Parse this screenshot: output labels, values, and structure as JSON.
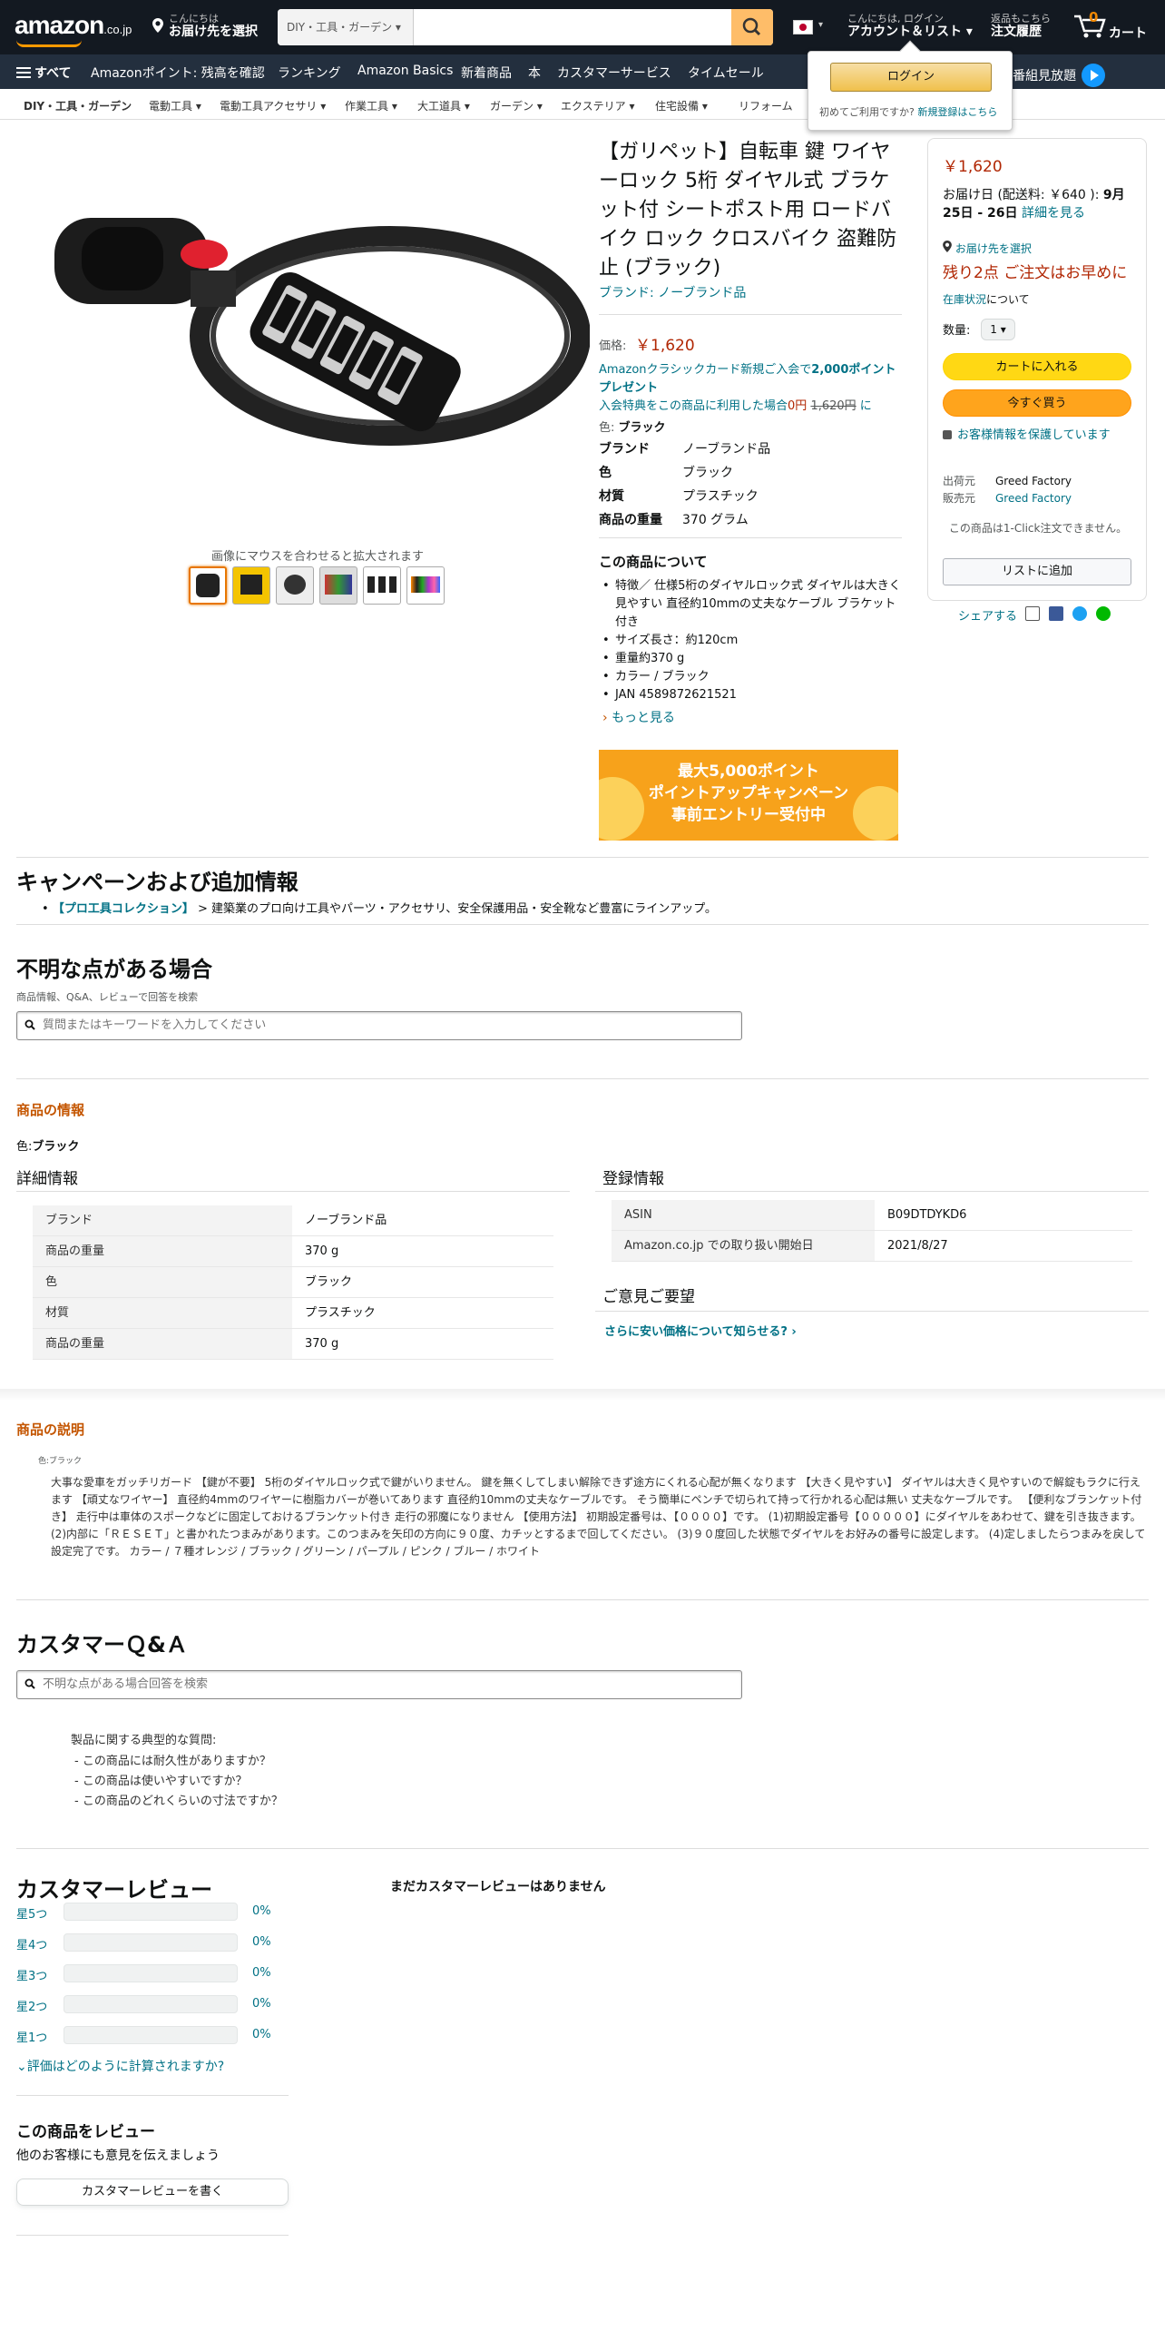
{
  "header": {
    "logo": "amazon",
    "logo_suffix": ".co.jp",
    "deliver_small": "こんにちは",
    "deliver_main": "お届け先を選択",
    "search_category": "DIY・工具・ガーデン ▾",
    "account_small": "こんにちは, ログイン",
    "account_main": "アカウント＆リスト ▾",
    "orders_small": "返品もこちら",
    "orders_main": "注文履歴",
    "cart_label": "カート",
    "cart_count": "0"
  },
  "nav": {
    "all": "すべて",
    "items": [
      "Amazonポイント: 残高を確認",
      "ランキング",
      "Amazon Basics",
      "新着商品",
      "本",
      "カスタマーサービス",
      "タイムセール"
    ],
    "right": "映画・TV番組見放題"
  },
  "subnav": [
    "DIY・工具・ガーデン",
    "電動工具 ▾",
    "電動工具アクセサリ ▾",
    "作業工具 ▾",
    "大工道具 ▾",
    "ガーデン ▾",
    "エクステリア ▾",
    "住宅設備 ▾",
    "リフォーム"
  ],
  "flyout": {
    "login": "ログイン",
    "new_user": "初めてご利用ですか?",
    "register": "新規登録はこちら"
  },
  "gallery": {
    "hint": "画像にマウスを合わせると拡大されます"
  },
  "product": {
    "title": "【ガリペット】自転車 鍵 ワイヤーロック 5桁 ダイヤル式 ブラケット付 シートポスト用 ロードバイク ロック クロスバイク 盗難防止 (ブラック)",
    "brand_link": "ブランド: ノーブランド品",
    "price_label": "価格:",
    "price": "￥1,620",
    "promo1": "Amazonクラシックカード新規ご入会で",
    "promo_points": "2,000ポイントプレゼント",
    "promo2": "入会特典をこの商品に利用した場合",
    "promo_zero": "0円",
    "promo_strike": "1,620円",
    "promo_tail": "に",
    "color_label": "色:",
    "color_value": "ブラック",
    "specs": [
      {
        "k": "ブランド",
        "v": "ノーブランド品"
      },
      {
        "k": "色",
        "v": "ブラック"
      },
      {
        "k": "材質",
        "v": "プラスチック"
      },
      {
        "k": "商品の重量",
        "v": "370 グラム"
      }
    ],
    "about_title": "この商品について",
    "about": [
      "特徴／ 仕様5桁のダイヤルロック式 ダイヤルは大きく見やすい 直径約10mmの丈夫なケーブル ブラケット付き",
      "サイズ長さ：約120cm",
      "重量約370 g",
      "カラー / ブラック",
      "JAN 4589872621521"
    ],
    "more": "もっと見る",
    "banner_lines": [
      "最大5,000ポイント",
      "ポイントアップキャンペーン",
      "事前エントリー受付中"
    ]
  },
  "buybox": {
    "price": "￥1,620",
    "delivery_prefix": "お届け日 (配送料: ￥640 ):",
    "delivery_date": "9月25日 - 26日",
    "delivery_link": "詳細を見る",
    "location": "お届け先を選択",
    "stock": "残り2点 ご注文はお早めに",
    "stock_link": "在庫状況",
    "stock_tail": "について",
    "qty_label": "数量:",
    "qty_value": "1 ▾",
    "add_cart": "カートに入れる",
    "buy_now": "今すぐ買う",
    "secure": "お客様情報を保護しています",
    "ships_from_k": "出荷元",
    "ships_from_v": "Greed Factory",
    "sold_by_k": "販売元",
    "sold_by_v": "Greed Factory",
    "one_click": "この商品は1-Click注文できません。",
    "add_list": "リストに追加",
    "share": "シェアする"
  },
  "campaign": {
    "title": "キャンペーンおよび追加情報",
    "link": "【プロ工具コレクション】",
    "text": " > 建築業のプロ向け工具やパーツ・アクセサリ、安全保護用品・安全靴など豊富にラインアップ。"
  },
  "questions": {
    "title": "不明な点がある場合",
    "sub": "商品情報、Q&A、レビューで回答を検索",
    "placeholder": "質問またはキーワードを入力してください"
  },
  "info": {
    "title": "商品の情報",
    "color_label": "色:",
    "color_value": "ブラック",
    "detail_title": "詳細情報",
    "detail_rows": [
      {
        "k": "ブランド",
        "v": "ノーブランド品"
      },
      {
        "k": "商品の重量",
        "v": "370 g"
      },
      {
        "k": "色",
        "v": "ブラック"
      },
      {
        "k": "材質",
        "v": "プラスチック"
      },
      {
        "k": "商品の重量",
        "v": "370 g"
      }
    ],
    "reg_title": "登録情報",
    "reg_rows": [
      {
        "k": "ASIN",
        "v": "B09DTDYKD6"
      },
      {
        "k": "Amazon.co.jp での取り扱い開始日",
        "v": "2021/8/27"
      }
    ],
    "feedback_title": "ご意見ご要望",
    "feedback_link": "さらに安い価格について知らせる? ›"
  },
  "description": {
    "title": "商品の説明",
    "color_small": "色:ブラック",
    "text": "大事な愛車をガッチリガード 【鍵が不要】 5桁のダイヤルロック式で鍵がいりません。 鍵を無くしてしまい解除できず途方にくれる心配が無くなります 【大きく見やすい】 ダイヤルは大きく見やすいので解錠もラクに行えます 【頑丈なワイヤー】 直径約4mmのワイヤーに樹脂カバーが巻いてあります 直径約10mmの丈夫なケーブルです。 そう簡単にペンチで切られて持って行かれる心配は無い 丈夫なケーブルです。 【便利なブランケット付き】 走行中は車体のスポークなどに固定しておけるブランケット付き 走行の邪魔になりません 【使用方法】 初期設定番号は、【００００】です。 (1)初期設定番号【０００００】にダイヤルをあわせて、鍵を引き抜きます。 (2)内部に「ＲＥＳＥＴ」と書かれたつまみがあります。このつまみを矢印の方向に９０度、カチッとするまで回してください。 (3)９０度回した状態でダイヤルをお好みの番号に設定します。 (4)定しましたらつまみを戻して設定完了です。 カラー / ７種オレンジ / ブラック / グリーン / パープル / ピンク / ブルー / ホワイト"
  },
  "qa": {
    "title": "カスタマーＱ&Ａ",
    "placeholder": "不明な点がある場合回答を検索",
    "typical": "製品に関する典型的な質問:",
    "items": [
      "この商品には耐久性がありますか？",
      "この商品は使いやすいですか？",
      "この商品のどれくらいの寸法ですか？"
    ]
  },
  "reviews": {
    "title": "カスタマーレビュー",
    "none": "まだカスタマーレビューはありません",
    "stars": [
      {
        "label": "星5つ",
        "pct": "0%",
        "value": 0
      },
      {
        "label": "星4つ",
        "pct": "0%",
        "value": 0
      },
      {
        "label": "星3つ",
        "pct": "0%",
        "value": 0
      },
      {
        "label": "星2つ",
        "pct": "0%",
        "value": 0
      },
      {
        "label": "星1つ",
        "pct": "0%",
        "value": 0
      }
    ],
    "how": "評価はどのように計算されますか?",
    "write_title": "この商品をレビュー",
    "write_sub": "他のお客様にも意見を伝えましょう",
    "write_button": "カスタマーレビューを書く"
  },
  "colors": {
    "accent": "#ff9900",
    "price": "#b12704",
    "link": "#007185",
    "header": "#131921",
    "nav": "#232f3e"
  }
}
